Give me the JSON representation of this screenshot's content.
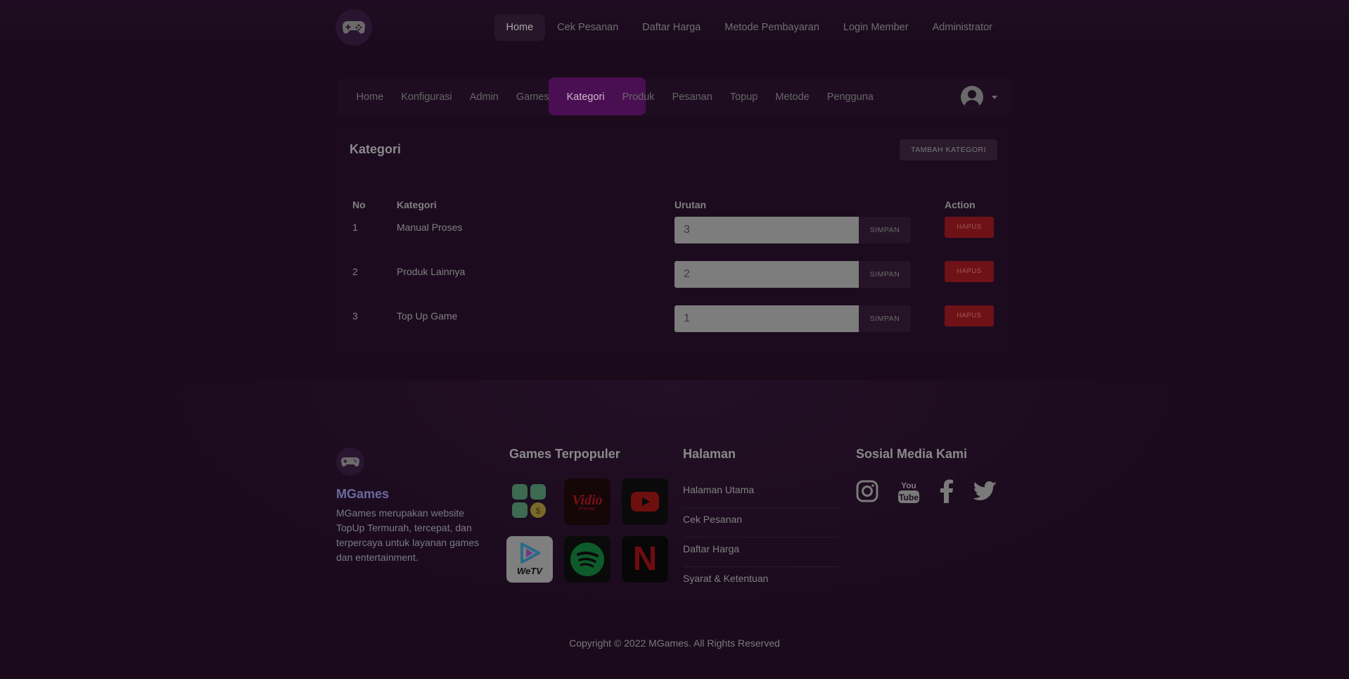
{
  "topnav": {
    "items": [
      "Home",
      "Cek Pesanan",
      "Daftar Harga",
      "Metode Pembayaran",
      "Login Member",
      "Administrator"
    ],
    "active": "Home"
  },
  "adminnav": {
    "items": [
      "Home",
      "Konfigurasi",
      "Admin",
      "Games",
      "Kategori",
      "Produk",
      "Pesanan",
      "Topup",
      "Metode",
      "Pengguna"
    ],
    "active": "Kategori"
  },
  "card": {
    "title": "Kategori",
    "add_button": "TAMBAH KATEGORI"
  },
  "table": {
    "headers": {
      "no": "No",
      "kategori": "Kategori",
      "urutan": "Urutan",
      "action": "Action"
    },
    "rows": [
      {
        "no": "1",
        "kategori": "Manual Proses",
        "urutan": "3",
        "save": "SIMPAN",
        "delete": "HAPUS"
      },
      {
        "no": "2",
        "kategori": "Produk Lainnya",
        "urutan": "2",
        "save": "SIMPAN",
        "delete": "HAPUS"
      },
      {
        "no": "3",
        "kategori": "Top Up Game",
        "urutan": "1",
        "save": "SIMPAN",
        "delete": "HAPUS"
      }
    ]
  },
  "footer": {
    "brand": "MGames",
    "description": "MGames merupakan website TopUp Termurah, tercepat, dan terpercaya untuk layanan games dan entertainment.",
    "games_title": "Games Terpopuler",
    "games": [
      {
        "icon": "app-grid-icon",
        "color": "#2e4a35"
      },
      {
        "icon": "vidio-logo",
        "label": "Vidio",
        "sublabel": "Premier",
        "color": "#1a0a0c"
      },
      {
        "icon": "youtube-icon",
        "color": "#0e0e0e"
      },
      {
        "icon": "wetv-logo",
        "label": "WeTV",
        "color": "#8a8a8a"
      },
      {
        "icon": "spotify-icon",
        "color": "#0e0e0e"
      },
      {
        "icon": "netflix-logo",
        "label": "N",
        "color": "#0a0a0a"
      }
    ],
    "pages_title": "Halaman",
    "pages": [
      "Halaman Utama",
      "Cek Pesanan",
      "Daftar Harga",
      "Syarat & Ketentuan"
    ],
    "social_title": "Sosial Media Kami",
    "socials": [
      "instagram-icon",
      "youtube-icon",
      "facebook-icon",
      "twitter-icon"
    ],
    "copyright": "Copyright © 2022 MGames. All Rights Reserved"
  }
}
